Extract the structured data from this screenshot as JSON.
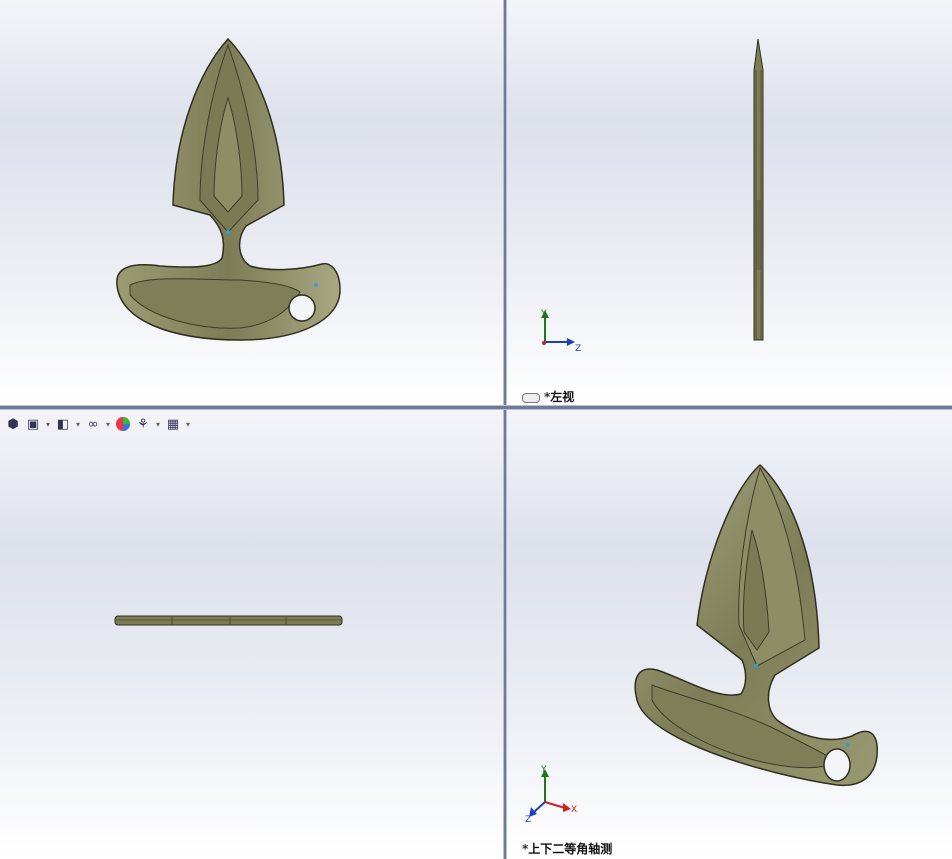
{
  "viewports": {
    "front": {
      "label": ""
    },
    "left": {
      "label": "*左视"
    },
    "top": {
      "label": ""
    },
    "iso": {
      "label": "*上下二等角轴测"
    }
  },
  "triad": {
    "left": {
      "x": "",
      "y": "Y",
      "z": "Z"
    },
    "iso": {
      "x": "X",
      "y": "Y",
      "z": "Z"
    }
  },
  "toolbar": {
    "items": [
      "view-orientation-icon",
      "display-style-icon",
      "hide-show-icon",
      "edit-appearance-icon",
      "apply-scene-icon",
      "view-settings-icon"
    ]
  },
  "colors": {
    "part_fill": "#8a8a62",
    "part_dark": "#5d5d3e",
    "part_light": "#b4b48c",
    "divider": "#6e7a96"
  }
}
